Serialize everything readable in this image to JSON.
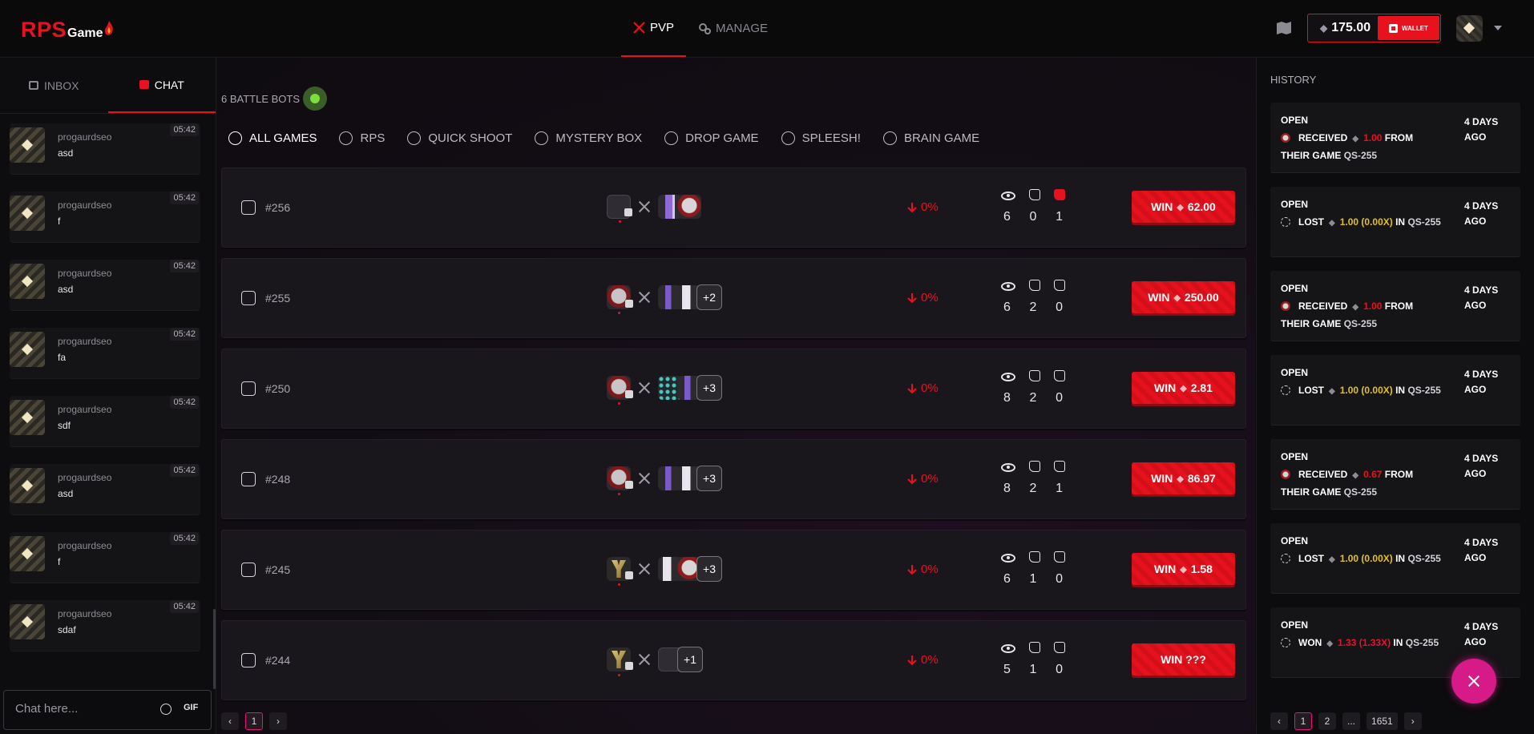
{
  "brand": {
    "logo_rps": "RPS",
    "logo_game": "Game"
  },
  "topnav": [
    {
      "label": "PVP",
      "active": true
    },
    {
      "label": "MANAGE",
      "active": false
    }
  ],
  "wallet": {
    "balance": "175.00",
    "button_label": "WALLET"
  },
  "left": {
    "tabs": [
      {
        "label": "INBOX",
        "active": false
      },
      {
        "label": "CHAT",
        "active": true
      }
    ],
    "messages": [
      {
        "user": "progaurdseo",
        "text": "asd",
        "time": "05:42"
      },
      {
        "user": "progaurdseo",
        "text": "f",
        "time": "05:42"
      },
      {
        "user": "progaurdseo",
        "text": "asd",
        "time": "05:42"
      },
      {
        "user": "progaurdseo",
        "text": "fa",
        "time": "05:42"
      },
      {
        "user": "progaurdseo",
        "text": "sdf",
        "time": "05:42"
      },
      {
        "user": "progaurdseo",
        "text": "asd",
        "time": "05:42"
      },
      {
        "user": "progaurdseo",
        "text": "f",
        "time": "05:42"
      },
      {
        "user": "progaurdseo",
        "text": "sdaf",
        "time": "05:42"
      }
    ],
    "input_placeholder": "Chat here...",
    "gif_label": "GIF"
  },
  "main": {
    "bots_label": "6 BATTLE BOTS",
    "tabs": [
      {
        "label": "ALL GAMES",
        "active": true
      },
      {
        "label": "RPS",
        "active": false
      },
      {
        "label": "QUICK SHOOT",
        "active": false
      },
      {
        "label": "MYSTERY BOX",
        "active": false
      },
      {
        "label": "DROP GAME",
        "active": false
      },
      {
        "label": "SPLEESH!",
        "active": false
      },
      {
        "label": "BRAIN GAME",
        "active": false
      }
    ],
    "games": [
      {
        "id": "#256",
        "more": "",
        "pct": "0%",
        "views": "6",
        "likes": "0",
        "dislikes": "1",
        "win_prefix": "WIN",
        "win_amount": "62.00",
        "show_eth": true
      },
      {
        "id": "#255",
        "more": "+2",
        "pct": "0%",
        "views": "6",
        "likes": "2",
        "dislikes": "0",
        "win_prefix": "WIN",
        "win_amount": "250.00",
        "show_eth": true
      },
      {
        "id": "#250",
        "more": "+3",
        "pct": "0%",
        "views": "8",
        "likes": "2",
        "dislikes": "0",
        "win_prefix": "WIN",
        "win_amount": "2.81",
        "show_eth": true
      },
      {
        "id": "#248",
        "more": "+3",
        "pct": "0%",
        "views": "8",
        "likes": "2",
        "dislikes": "1",
        "win_prefix": "WIN",
        "win_amount": "86.97",
        "show_eth": true
      },
      {
        "id": "#245",
        "more": "+3",
        "pct": "0%",
        "views": "6",
        "likes": "1",
        "dislikes": "0",
        "win_prefix": "WIN",
        "win_amount": "1.58",
        "show_eth": true
      },
      {
        "id": "#244",
        "more": "+1",
        "pct": "0%",
        "views": "5",
        "likes": "1",
        "dislikes": "0",
        "win_prefix": "WIN ???",
        "win_amount": "",
        "show_eth": false
      }
    ],
    "pager": {
      "prev": "‹",
      "page": "1",
      "next": "›"
    }
  },
  "history": {
    "title": "HISTORY",
    "items": [
      {
        "status": "OPEN",
        "action": "RECEIVED",
        "amount": "1.00",
        "tail": "FROM THEIR GAME",
        "game": "QS-255",
        "time": "4 DAYS AGO",
        "icon": "bot",
        "color": "red"
      },
      {
        "status": "OPEN",
        "action": "LOST",
        "amount": "1.00 (0.00X)",
        "tail": "IN",
        "game": "QS-255",
        "time": "4 DAYS AGO",
        "icon": "dash",
        "color": "yellow"
      },
      {
        "status": "OPEN",
        "action": "RECEIVED",
        "amount": "1.00",
        "tail": "FROM THEIR GAME",
        "game": "QS-255",
        "time": "4 DAYS AGO",
        "icon": "bot",
        "color": "red"
      },
      {
        "status": "OPEN",
        "action": "LOST",
        "amount": "1.00 (0.00X)",
        "tail": "IN",
        "game": "QS-255",
        "time": "4 DAYS AGO",
        "icon": "dash",
        "color": "yellow"
      },
      {
        "status": "OPEN",
        "action": "RECEIVED",
        "amount": "0.67",
        "tail": "FROM THEIR GAME",
        "game": "QS-255",
        "time": "4 DAYS AGO",
        "icon": "bot",
        "color": "red"
      },
      {
        "status": "OPEN",
        "action": "LOST",
        "amount": "1.00 (0.00X)",
        "tail": "IN",
        "game": "QS-255",
        "time": "4 DAYS AGO",
        "icon": "dash",
        "color": "yellow"
      },
      {
        "status": "OPEN",
        "action": "WON",
        "amount": "1.33 (1.33X)",
        "tail": "IN",
        "game": "QS-255",
        "time": "4 DAYS AGO",
        "icon": "dash",
        "color": "pink"
      }
    ],
    "pager": [
      "‹",
      "1",
      "2",
      "...",
      "1651",
      "›"
    ]
  },
  "colors": {
    "accent": "#e8121f",
    "fab": "#d61a87",
    "online": "#7de03a"
  }
}
